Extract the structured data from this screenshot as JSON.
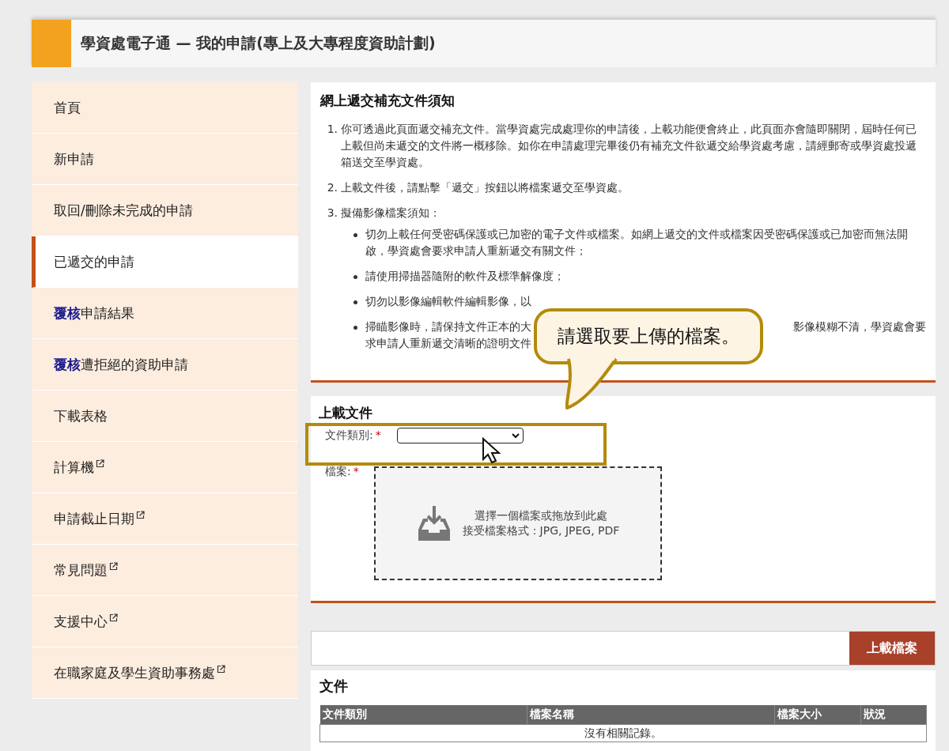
{
  "header": {
    "title": "學資處電子通 — 我的申請(專上及大專程度資助計劃)"
  },
  "sidebar": {
    "items": [
      {
        "label": "首頁",
        "selected": false,
        "external": false
      },
      {
        "label": "新申請",
        "selected": false,
        "external": false
      },
      {
        "label": "取回/刪除未完成的申請",
        "selected": false,
        "external": false
      },
      {
        "label": "已遞交的申請",
        "selected": true,
        "external": false
      },
      {
        "prefix": "覆核",
        "label": "申請結果",
        "selected": false,
        "external": false
      },
      {
        "prefix": "覆核",
        "label": "遭拒絕的資助申請",
        "selected": false,
        "external": false
      },
      {
        "label": "下載表格",
        "selected": false,
        "external": false
      },
      {
        "label": "計算機",
        "selected": false,
        "external": true
      },
      {
        "label": "申請截止日期",
        "selected": false,
        "external": true
      },
      {
        "label": "常見問題",
        "selected": false,
        "external": true
      },
      {
        "label": "支援中心",
        "selected": false,
        "external": true
      },
      {
        "label": "在職家庭及學生資助事務處",
        "selected": false,
        "external": true
      }
    ]
  },
  "notice": {
    "title": "網上遞交補充文件須知",
    "items": [
      {
        "number": "1.",
        "text": "你可透過此頁面遞交補充文件。當學資處完成處理你的申請後，上載功能便會終止，此頁面亦會隨即關閉，屆時任何已上載但尚未遞交的文件將一概移除。如你在申請處理完畢後仍有補充文件欲遞交給學資處考慮，請經郵寄或學資處投遞箱送交至學資處。"
      },
      {
        "number": "2.",
        "text": "上載文件後，請點擊「遞交」按鈕以將檔案遞交至學資處。"
      },
      {
        "number": "3.",
        "text": "擬備影像檔案須知：",
        "bullets": [
          {
            "segments": [
              "切勿上載任何受密碼保護或已加密的電子文件或檔案。如網上遞交的文件或檔案因受密碼保護或已加密而無法開啟，學資處會要求申請人重新遞交有關文件；"
            ]
          },
          {
            "segments": [
              "請使用掃描器隨附的軟件及標準解像度；"
            ]
          },
          {
            "segments": [
              "切勿以影像編輯軟件編輯影像，以"
            ]
          },
          {
            "segments": [
              "掃瞄影像時，請保持文件正本的大",
              "影像模糊不清，學資處會要",
              "求申請人重新遞交清晰的證明文件"
            ]
          }
        ]
      }
    ]
  },
  "upload": {
    "title": "上載文件",
    "type_label": "文件類別:",
    "file_label": "檔案:",
    "required_mark": "*",
    "drop_line_1": "選擇一個檔案或拖放到此處",
    "drop_line_2": "接受檔案格式：JPG, JPEG, PDF"
  },
  "upload_bar": {
    "button": "上載檔案"
  },
  "documents": {
    "title": "文件",
    "columns": [
      "文件類別",
      "檔案名稱",
      "檔案大小",
      "狀況"
    ],
    "empty_message": "沒有相關記錄。"
  },
  "callout": {
    "text": "請選取要上傳的檔案。"
  }
}
